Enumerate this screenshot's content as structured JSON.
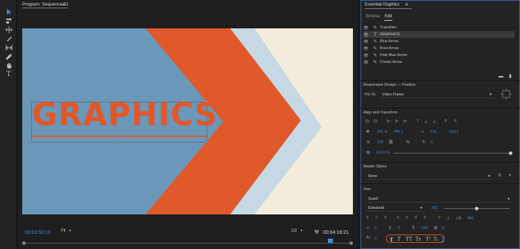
{
  "program_monitor": {
    "tab_title": "Program: Sequence 01",
    "menu_icon": "≡",
    "graphic_text": "GRAPHICS",
    "timecode_current": "00:03:50:10",
    "zoom_select": "Fit",
    "resolution_select": "1/2",
    "timecode_duration": "00:04:18:21"
  },
  "colors": {
    "canvas_bg": "#f2eddc",
    "blue_arrow": "#6b97b8",
    "rust_arrow": "#e0592b",
    "pale_blue_arrow": "#c6d8e4",
    "text": "#e2572a",
    "accent_blue": "#3d8fe6"
  },
  "essential_graphics": {
    "title": "Essential Graphics",
    "menu_icon": "≡",
    "tabs": [
      {
        "label": "Browse",
        "active": false
      },
      {
        "label": "Edit",
        "active": true
      }
    ],
    "layers": [
      {
        "name": "Transition",
        "icon": "pen-icon",
        "selected": false
      },
      {
        "name": "GRAPHICS",
        "icon": "text-icon",
        "selected": true
      },
      {
        "name": "Blue Arrow",
        "icon": "pen-icon",
        "selected": false
      },
      {
        "name": "Rust Arrow",
        "icon": "pen-icon",
        "selected": false
      },
      {
        "name": "Pale Blue Arrow",
        "icon": "pen-icon",
        "selected": false
      },
      {
        "name": "Cream Arrow",
        "icon": "pen-icon",
        "selected": false
      }
    ],
    "responsive_design": {
      "title": "Responsive Design — Position",
      "pin_to_label": "Pin To:",
      "pin_to_value": "Video Frame"
    },
    "align_transform": {
      "title": "Align and Transform",
      "position_x": "561.4,",
      "position_y": "495.1",
      "anchor_x": "6.8,",
      "anchor_y": "-103.2",
      "scale": "100",
      "scale_unit": "%",
      "rotation": "0",
      "opacity": "100.0 %"
    },
    "master_styles": {
      "title": "Master Styles",
      "value": "None"
    },
    "text": {
      "title": "Text",
      "font": "Sole8",
      "weight": "Extrabold",
      "size": "202",
      "tracking_value": "400",
      "kerning": "0",
      "leading": "0",
      "tsume": "-150",
      "baseline": "0",
      "extra_value": "0"
    },
    "style_buttons": [
      "T",
      "T",
      "TT",
      "Tт",
      "T¹",
      "T₁",
      "T"
    ]
  }
}
